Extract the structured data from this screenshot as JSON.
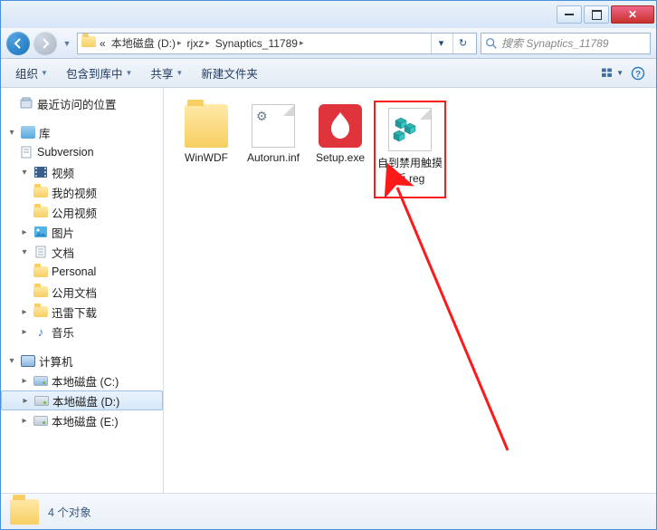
{
  "breadcrumb": {
    "prefix": "«",
    "items": [
      "本地磁盘 (D:)",
      "rjxz",
      "Synaptics_11789"
    ]
  },
  "search": {
    "placeholder": "搜索 Synaptics_11789"
  },
  "toolbar": {
    "organize": "组织",
    "include": "包含到库中",
    "share": "共享",
    "newfolder": "新建文件夹"
  },
  "sidebar": {
    "recent": "最近访问的位置",
    "libraries": "库",
    "subversion": "Subversion",
    "video": "视频",
    "myvideo": "我的视频",
    "publicvideo": "公用视频",
    "pictures": "图片",
    "documents": "文档",
    "personal": "Personal",
    "publicdoc": "公用文档",
    "xunlei": "迅雷下载",
    "music": "音乐",
    "computer": "计算机",
    "drive_c": "本地磁盘 (C:)",
    "drive_d": "本地磁盘 (D:)",
    "drive_e": "本地磁盘 (E:)"
  },
  "files": {
    "f1": "WinWDF",
    "f2": "Autorun.inf",
    "f3": "Setup.exe",
    "f4": "自到禁用触摸板.reg"
  },
  "status": {
    "text": "4 个对象"
  }
}
